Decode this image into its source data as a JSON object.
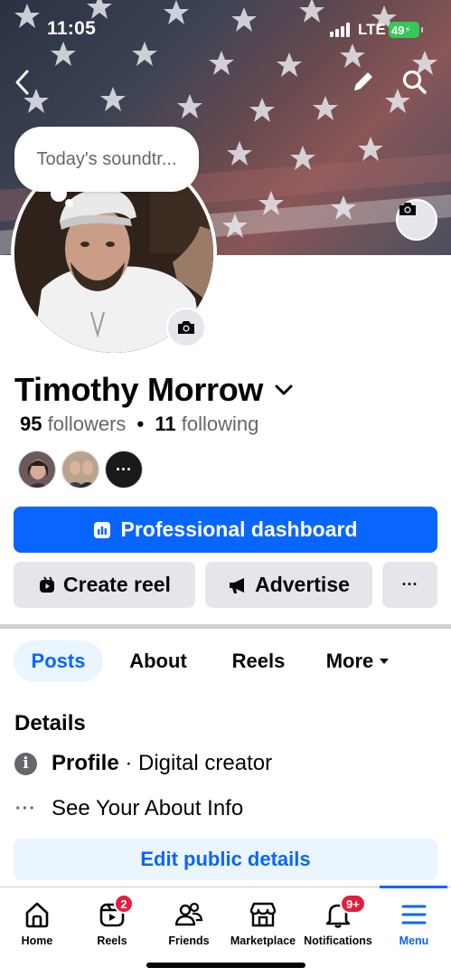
{
  "status_bar": {
    "time": "11:05",
    "network": "LTE",
    "battery": "49"
  },
  "header": {
    "back_icon": "chevron-left-icon",
    "edit_icon": "pencil-icon",
    "search_icon": "search-icon"
  },
  "note": {
    "text": "Today's soundtr..."
  },
  "profile": {
    "name": "Timothy Morrow",
    "followers_count": "95",
    "followers_label": "followers",
    "separator": "•",
    "following_count": "11",
    "following_label": "following",
    "more_friends": "···"
  },
  "actions": {
    "dashboard_label": "Professional dashboard",
    "create_reel_label": "Create reel",
    "advertise_label": "Advertise",
    "more_label": "···"
  },
  "tabs": [
    {
      "label": "Posts",
      "active": true
    },
    {
      "label": "About"
    },
    {
      "label": "Reels"
    },
    {
      "label": "More"
    }
  ],
  "details": {
    "title": "Details",
    "profile_label": "Profile",
    "profile_value": " · Digital creator",
    "about_link": "See Your About Info",
    "info_icon": "i",
    "dots_icon": "···",
    "edit_button": "Edit public details"
  },
  "bottom_nav": [
    {
      "label": "Home",
      "icon": "home-icon"
    },
    {
      "label": "Reels",
      "icon": "reels-icon",
      "badge": "2"
    },
    {
      "label": "Friends",
      "icon": "friends-icon"
    },
    {
      "label": "Marketplace",
      "icon": "marketplace-icon"
    },
    {
      "label": "Notifications",
      "icon": "bell-icon",
      "badge": "9+"
    },
    {
      "label": "Menu",
      "icon": "menu-icon",
      "active": true
    }
  ],
  "colors": {
    "brand_blue": "#0866ff",
    "badge_red": "#e41e3f",
    "gray_button": "#e4e6eb"
  }
}
